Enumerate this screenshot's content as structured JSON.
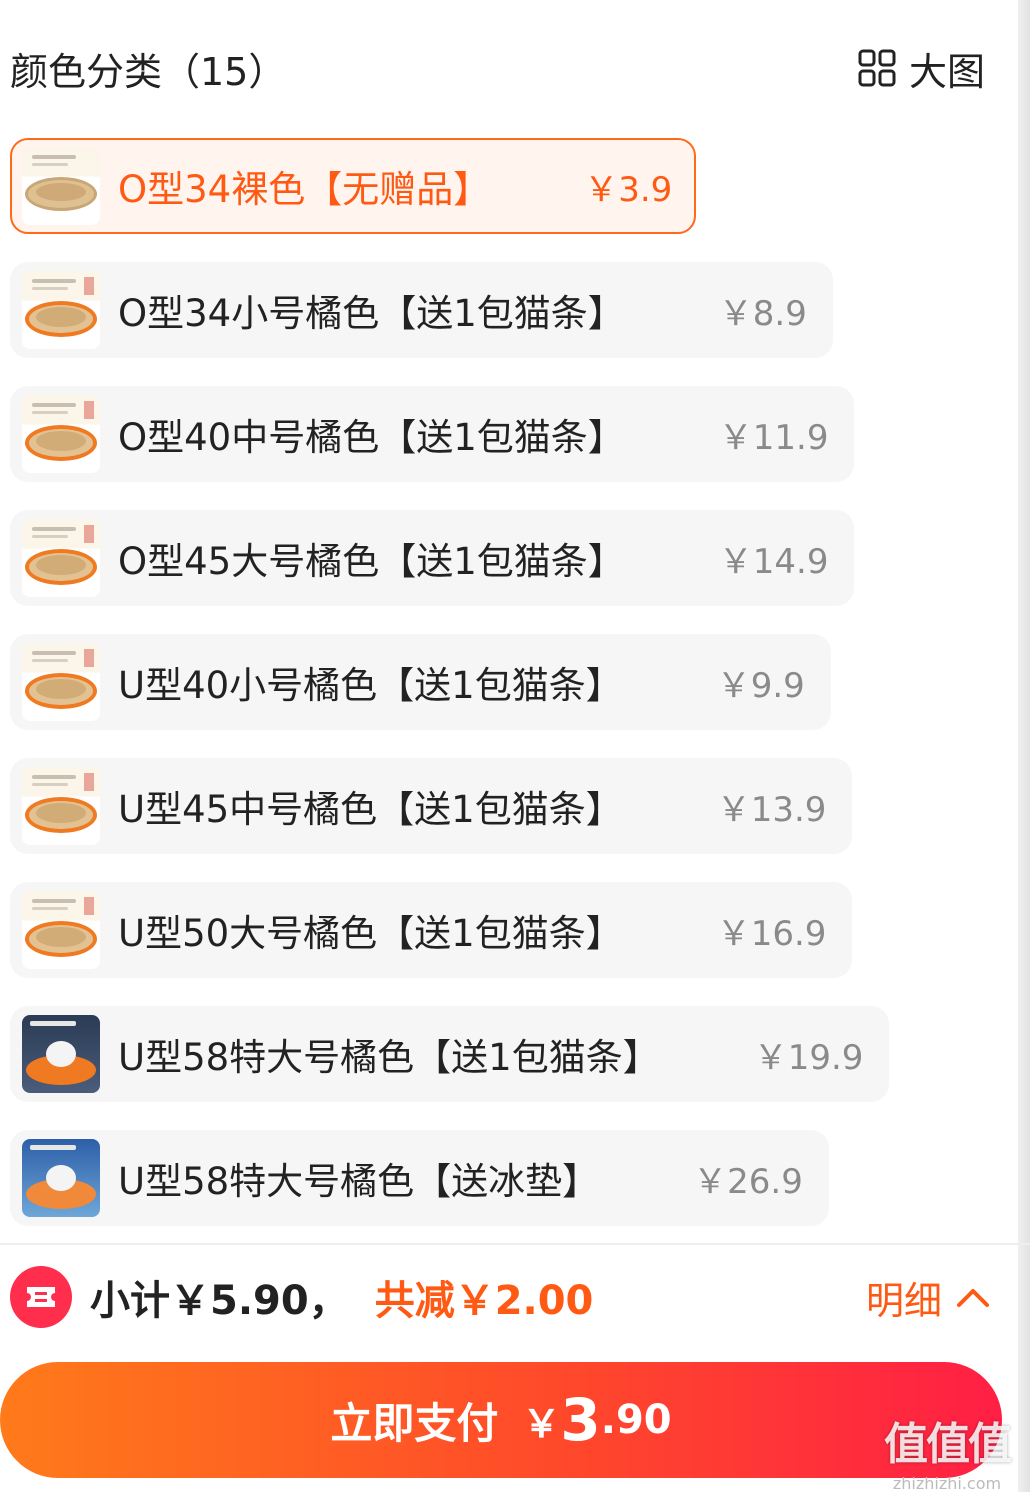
{
  "header": {
    "title": "颜色分类（15）",
    "big_view_label": "大图"
  },
  "options": [
    {
      "label": "O型34裸色【无赠品】",
      "price": "￥3.9",
      "selected": true,
      "thumb": "bowl-plain"
    },
    {
      "label": "O型34小号橘色【送1包猫条】",
      "price": "￥8.9",
      "selected": false,
      "thumb": "bowl-orange"
    },
    {
      "label": "O型40中号橘色【送1包猫条】",
      "price": "￥11.9",
      "selected": false,
      "thumb": "bowl-orange"
    },
    {
      "label": "O型45大号橘色【送1包猫条】",
      "price": "￥14.9",
      "selected": false,
      "thumb": "bowl-orange"
    },
    {
      "label": "U型40小号橘色【送1包猫条】",
      "price": "￥9.9",
      "selected": false,
      "thumb": "bowl-orange"
    },
    {
      "label": "U型45中号橘色【送1包猫条】",
      "price": "￥13.9",
      "selected": false,
      "thumb": "bowl-orange"
    },
    {
      "label": "U型50大号橘色【送1包猫条】",
      "price": "￥16.9",
      "selected": false,
      "thumb": "bowl-orange"
    },
    {
      "label": "U型58特大号橘色【送1包猫条】",
      "price": "￥19.9",
      "selected": false,
      "thumb": "cat-bed"
    },
    {
      "label": "U型58特大号橘色【送冰垫】",
      "price": "￥26.9",
      "selected": false,
      "thumb": "cat-bed-ice"
    }
  ],
  "summary": {
    "subtotal": "小计￥5.90，",
    "discount": "共减￥2.00",
    "detail_label": "明细"
  },
  "pay": {
    "label": "立即支付",
    "currency": "￥",
    "amount_int": "3",
    "amount_dec": ".90"
  },
  "watermark": {
    "main": "值值值",
    "sub": "zhizhizhi.com"
  },
  "colors": {
    "accent": "#ff5a14",
    "coupon": "#ff2e4d",
    "option_bg": "#f6f6f6"
  }
}
